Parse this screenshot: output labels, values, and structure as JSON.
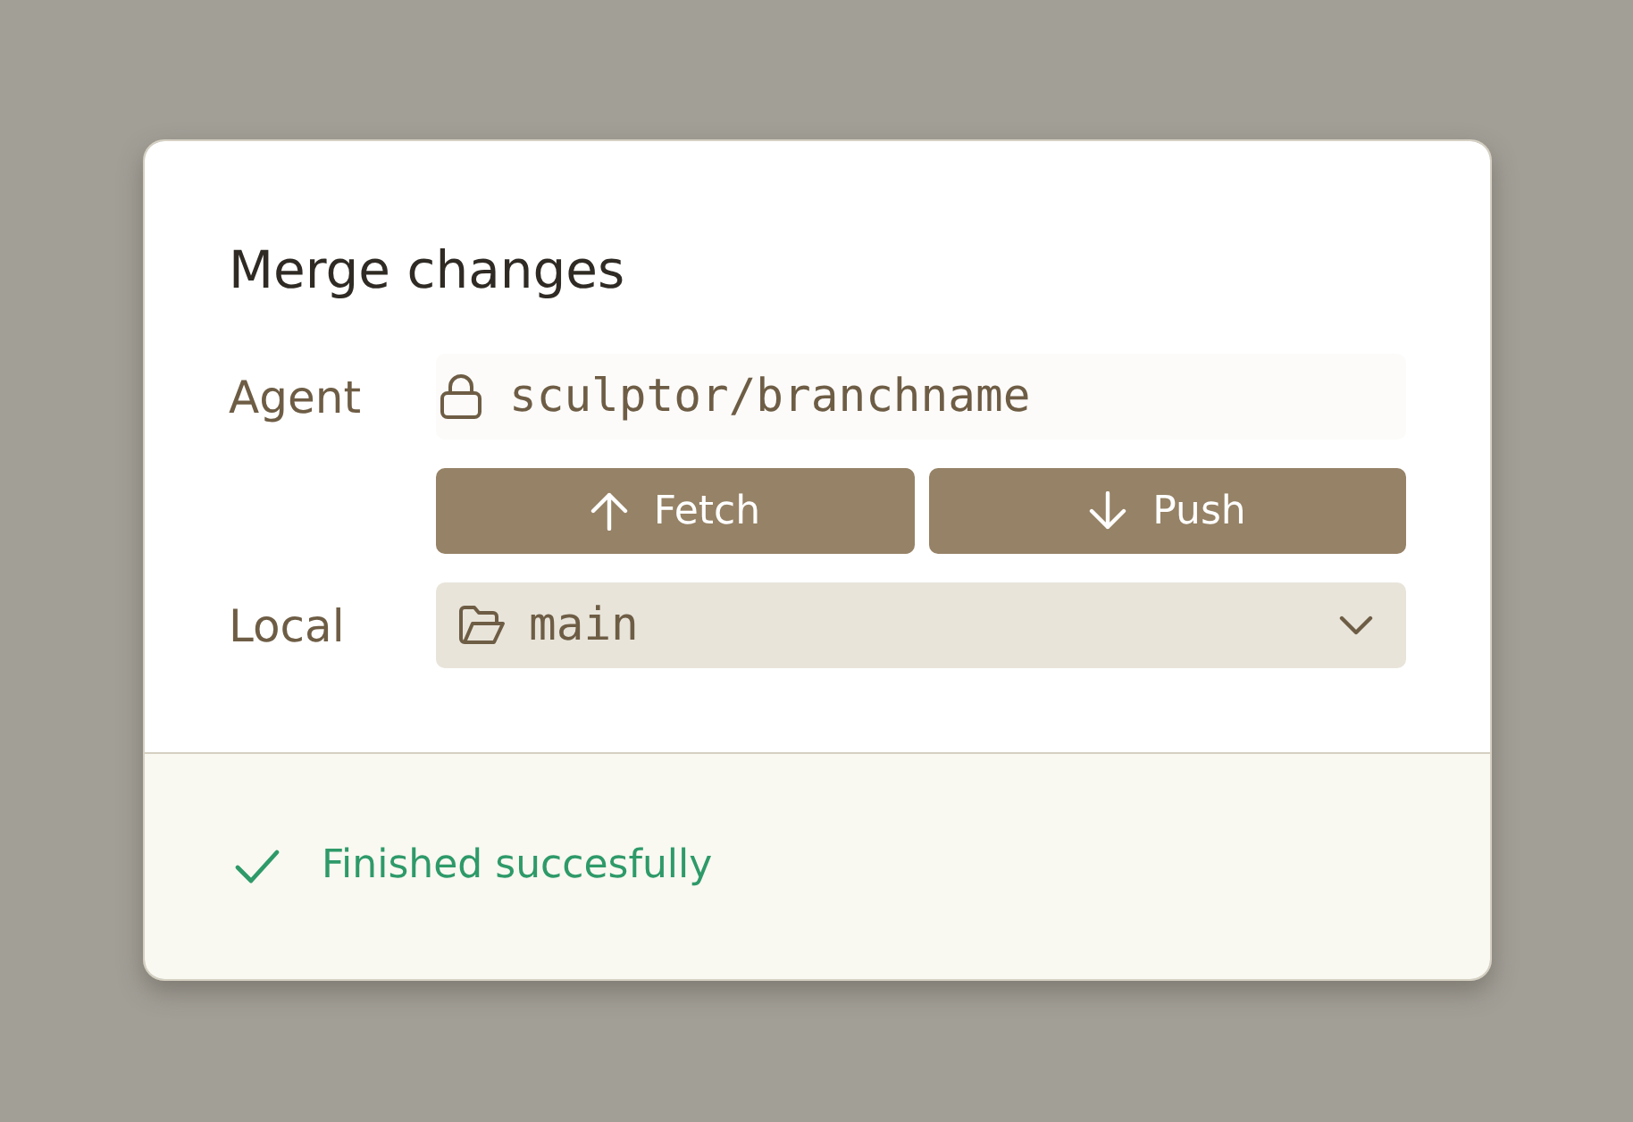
{
  "dialog": {
    "title": "Merge changes",
    "agent": {
      "label": "Agent",
      "branch": "sculptor/branchname"
    },
    "actions": [
      {
        "kind": "fetch",
        "label": "Fetch"
      },
      {
        "kind": "push",
        "label": "Push"
      }
    ],
    "local": {
      "label": "Local",
      "branch": "main"
    },
    "status": {
      "kind": "success",
      "text": "Finished succesfully"
    }
  }
}
